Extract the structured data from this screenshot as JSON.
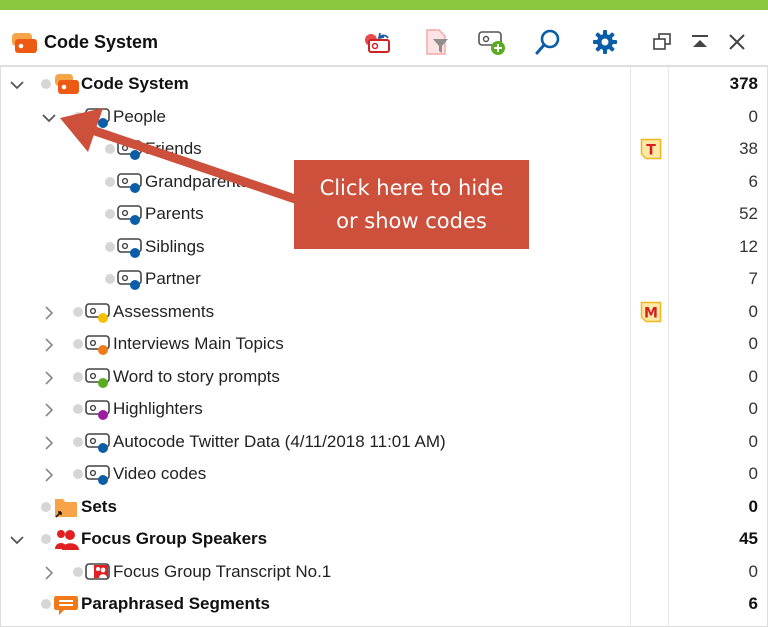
{
  "window": {
    "title": "Code System",
    "accent_color": "#8cc83f",
    "toolbar": [
      {
        "name": "activate-codes-icon",
        "tooltip": "Reset code activation"
      },
      {
        "name": "filter-icon",
        "tooltip": "Filter"
      },
      {
        "name": "new-code-icon",
        "tooltip": "New code"
      },
      {
        "name": "search-icon",
        "tooltip": "Search"
      },
      {
        "name": "gear-icon",
        "tooltip": "Settings"
      }
    ],
    "window_controls": [
      {
        "name": "undock-icon"
      },
      {
        "name": "collapse-icon"
      },
      {
        "name": "close-icon"
      }
    ]
  },
  "tree": [
    {
      "label": "Code System",
      "count": "378",
      "bold": true,
      "level": 0,
      "expander": "expanded",
      "icon": "code-system-icon",
      "memo": null
    },
    {
      "label": "People",
      "count": "0",
      "bold": false,
      "level": 1,
      "expander": "expanded",
      "icon": "code-icon",
      "color": "#0a5ea8",
      "memo": null
    },
    {
      "label": "Friends",
      "count": "38",
      "bold": false,
      "level": 2,
      "expander": null,
      "icon": "code-icon",
      "color": "#0a5ea8",
      "memo": "T"
    },
    {
      "label": "Grandparents",
      "count": "6",
      "bold": false,
      "level": 2,
      "expander": null,
      "icon": "code-icon",
      "color": "#0a5ea8",
      "memo": null
    },
    {
      "label": "Parents",
      "count": "52",
      "bold": false,
      "level": 2,
      "expander": null,
      "icon": "code-icon",
      "color": "#0a5ea8",
      "memo": null
    },
    {
      "label": "Siblings",
      "count": "12",
      "bold": false,
      "level": 2,
      "expander": null,
      "icon": "code-icon",
      "color": "#0a5ea8",
      "memo": null
    },
    {
      "label": "Partner",
      "count": "7",
      "bold": false,
      "level": 2,
      "expander": null,
      "icon": "code-icon",
      "color": "#0a5ea8",
      "memo": null
    },
    {
      "label": "Assessments",
      "count": "0",
      "bold": false,
      "level": 1,
      "expander": "collapsed",
      "icon": "code-icon",
      "color": "#f2c200",
      "memo": "M"
    },
    {
      "label": "Interviews Main Topics",
      "count": "0",
      "bold": false,
      "level": 1,
      "expander": "collapsed",
      "icon": "code-icon",
      "color": "#f07a1a",
      "memo": null
    },
    {
      "label": "Word to story prompts",
      "count": "0",
      "bold": false,
      "level": 1,
      "expander": "collapsed",
      "icon": "code-icon",
      "color": "#5aac1e",
      "memo": null
    },
    {
      "label": "Highlighters",
      "count": "0",
      "bold": false,
      "level": 1,
      "expander": "collapsed",
      "icon": "code-icon",
      "color": "#9a1fa0",
      "memo": null
    },
    {
      "label": "Autocode Twitter Data (4/11/2018 11:01 AM)",
      "count": "0",
      "bold": false,
      "level": 1,
      "expander": "collapsed",
      "icon": "code-icon",
      "color": "#0a5ea8",
      "memo": null
    },
    {
      "label": "Video codes",
      "count": "0",
      "bold": false,
      "level": 1,
      "expander": "collapsed",
      "icon": "code-icon",
      "color": "#0a5ea8",
      "memo": null
    },
    {
      "label": "Sets",
      "count": "0",
      "bold": true,
      "level": 0,
      "expander": null,
      "icon": "sets-folder-icon",
      "memo": null
    },
    {
      "label": "Focus Group Speakers",
      "count": "45",
      "bold": true,
      "level": 0,
      "expander": "expanded",
      "icon": "speakers-icon",
      "memo": null
    },
    {
      "label": "Focus Group Transcript No.1",
      "count": "0",
      "bold": false,
      "level": 1,
      "expander": "collapsed",
      "icon": "speaker-code-icon",
      "memo": null
    },
    {
      "label": "Paraphrased Segments",
      "count": "6",
      "bold": true,
      "level": 0,
      "expander": null,
      "icon": "paraphrase-icon",
      "memo": null
    }
  ],
  "callout": {
    "line1": "Click here to hide",
    "line2": "or show codes",
    "color": "#cc503b"
  }
}
